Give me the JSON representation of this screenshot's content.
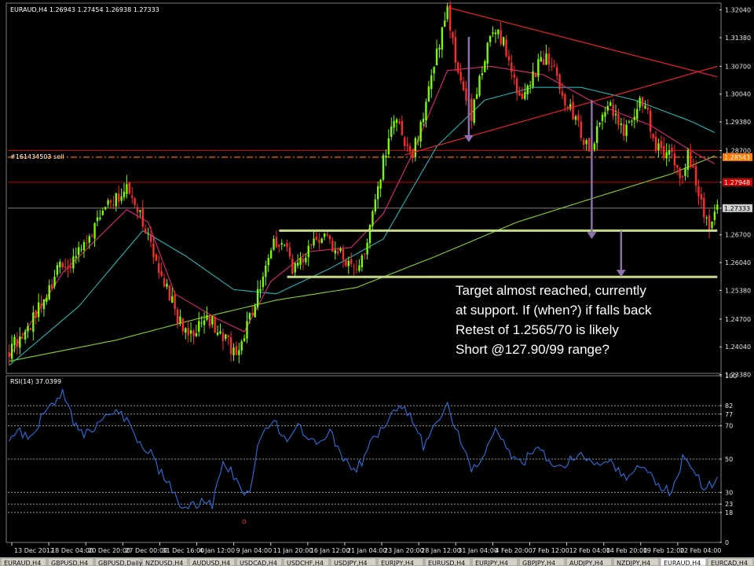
{
  "header": {
    "symbol_line": "EURAUD,H4  1.26943 1.27454 1.26938 1.27333",
    "order_label": "#161434503 sell",
    "rsi_label": "RSI(14) 37.0399"
  },
  "annotation": [
    "Target almost reached,  currently",
    "at support.  If (when?) if falls back",
    "Retest of 1.2565/70 is likely",
    "Short @127.90/99 range?"
  ],
  "colors": {
    "background": "#000000",
    "bull_candle": "#7cfc00",
    "bear_candle": "#ff2a2a",
    "ma_fast": "#e0257a",
    "ma_mid": "#27b5b5",
    "ma_slow": "#8ad22c",
    "triangle": "#e8202a",
    "support": "#c5d98a",
    "arrow": "#8d6fb0",
    "rsi_line": "#2f6fe0",
    "order_line": "#ff7a00",
    "hline_red": "#cc0000",
    "price_line": "#7f7f7f"
  },
  "chart_data": [
    {
      "type": "candlestick",
      "title": "EURAUD,H4",
      "ylim": [
        1.2341,
        1.322
      ],
      "y_ticks": [
        "1.32040",
        "1.31380",
        "1.30700",
        "1.30040",
        "1.29380",
        "1.28700",
        "1.28543",
        "1.27948",
        "1.27333",
        "1.26700",
        "1.26040",
        "1.25380",
        "1.24700",
        "1.24040",
        "1.23380"
      ],
      "x_labels": [
        "13 Dec 2012",
        "18 Dec 04:00",
        "20 Dec 20:00",
        "27 Dec 00:00",
        "31 Dec 16:00",
        "4 Jan 12:00",
        "9 Jan 04:00",
        "11 Jan 20:00",
        "16 Jan 12:00",
        "21 Jan 04:00",
        "23 Jan 20:00",
        "28 Jan 12:00",
        "31 Jan 04:00",
        "4 Feb 20:00",
        "7 Feb 12:00",
        "12 Feb 04:00",
        "14 Feb 20:00",
        "19 Feb 12:00",
        "22 Feb 04:00"
      ],
      "levels": {
        "order_sell": 1.28543,
        "resistance": 1.27948,
        "last_price": 1.27333,
        "support_upper": 1.268,
        "support_lower": 1.257
      },
      "path_points": [
        [
          0,
          1.2395
        ],
        [
          8,
          1.246
        ],
        [
          14,
          1.2525
        ],
        [
          19,
          1.2595
        ],
        [
          24,
          1.261
        ],
        [
          29,
          1.2645
        ],
        [
          33,
          1.27
        ],
        [
          38,
          1.2745
        ],
        [
          44,
          1.2785
        ],
        [
          50,
          1.27
        ],
        [
          54,
          1.263
        ],
        [
          58,
          1.2555
        ],
        [
          63,
          1.2475
        ],
        [
          68,
          1.243
        ],
        [
          72,
          1.2475
        ],
        [
          76,
          1.246
        ],
        [
          80,
          1.243
        ],
        [
          84,
          1.2395
        ],
        [
          87,
          1.241
        ],
        [
          89,
          1.246
        ],
        [
          93,
          1.253
        ],
        [
          96,
          1.259
        ],
        [
          99,
          1.265
        ],
        [
          103,
          1.266
        ],
        [
          106,
          1.259
        ],
        [
          110,
          1.261
        ],
        [
          114,
          1.266
        ],
        [
          118,
          1.267
        ],
        [
          122,
          1.264
        ],
        [
          126,
          1.261
        ],
        [
          130,
          1.26
        ],
        [
          134,
          1.265
        ],
        [
          138,
          1.279
        ],
        [
          142,
          1.29
        ],
        [
          145,
          1.294
        ],
        [
          148,
          1.288
        ],
        [
          151,
          1.2865
        ],
        [
          155,
          1.296
        ],
        [
          158,
          1.306
        ],
        [
          161,
          1.312
        ],
        [
          164,
          1.3205
        ],
        [
          167,
          1.308
        ],
        [
          170,
          1.302
        ],
        [
          173,
          1.295
        ],
        [
          176,
          1.303
        ],
        [
          179,
          1.312
        ],
        [
          182,
          1.315
        ],
        [
          185,
          1.313
        ],
        [
          188,
          1.305
        ],
        [
          191,
          1.2985
        ],
        [
          194,
          1.301
        ],
        [
          197,
          1.306
        ],
        [
          200,
          1.309
        ],
        [
          203,
          1.308
        ],
        [
          206,
          1.302
        ],
        [
          209,
          1.298
        ],
        [
          212,
          1.295
        ],
        [
          215,
          1.289
        ],
        [
          218,
          1.286
        ],
        [
          221,
          1.295
        ],
        [
          224,
          1.299
        ],
        [
          227,
          1.295
        ],
        [
          230,
          1.292
        ],
        [
          233,
          1.295
        ],
        [
          236,
          1.299
        ],
        [
          239,
          1.295
        ],
        [
          242,
          1.288
        ],
        [
          245,
          1.285
        ],
        [
          248,
          1.287
        ],
        [
          251,
          1.28
        ],
        [
          254,
          1.286
        ],
        [
          257,
          1.28
        ],
        [
          260,
          1.271
        ],
        [
          263,
          1.269
        ],
        [
          265,
          1.2733
        ]
      ],
      "ma_points": {
        "fast": [
          [
            0,
            1.238
          ],
          [
            20,
            1.258
          ],
          [
            44,
            1.273
          ],
          [
            52,
            1.27
          ],
          [
            62,
            1.253
          ],
          [
            78,
            1.247
          ],
          [
            88,
            1.244
          ],
          [
            98,
            1.256
          ],
          [
            112,
            1.263
          ],
          [
            128,
            1.264
          ],
          [
            140,
            1.272
          ],
          [
            150,
            1.285
          ],
          [
            164,
            1.306
          ],
          [
            180,
            1.307
          ],
          [
            200,
            1.305
          ],
          [
            220,
            1.298
          ],
          [
            240,
            1.293
          ],
          [
            255,
            1.287
          ],
          [
            265,
            1.2835
          ]
        ],
        "mid": [
          [
            0,
            1.236
          ],
          [
            26,
            1.25
          ],
          [
            50,
            1.268
          ],
          [
            66,
            1.262
          ],
          [
            84,
            1.254
          ],
          [
            100,
            1.253
          ],
          [
            120,
            1.259
          ],
          [
            140,
            1.266
          ],
          [
            160,
            1.288
          ],
          [
            178,
            1.299
          ],
          [
            196,
            1.302
          ],
          [
            214,
            1.302
          ],
          [
            234,
            1.299
          ],
          [
            255,
            1.294
          ],
          [
            265,
            1.291
          ]
        ],
        "slow": [
          [
            0,
            1.237
          ],
          [
            40,
            1.242
          ],
          [
            70,
            1.247
          ],
          [
            100,
            1.2515
          ],
          [
            130,
            1.2545
          ],
          [
            160,
            1.262
          ],
          [
            190,
            1.27
          ],
          [
            220,
            1.276
          ],
          [
            248,
            1.2815
          ],
          [
            265,
            1.286
          ]
        ]
      },
      "triangle": {
        "top_start": [
          164,
          1.321
        ],
        "top_end": [
          265,
          1.3045
        ],
        "bottom_start": [
          148,
          1.286
        ],
        "bottom_end": [
          265,
          1.307
        ]
      },
      "support_lines": [
        {
          "x0": 101,
          "x1": 265,
          "y": 1.268
        },
        {
          "x0": 104,
          "x1": 265,
          "y": 1.257
        }
      ],
      "arrows": [
        {
          "x": 172,
          "y0": 1.314,
          "y1": 1.289
        },
        {
          "x": 218,
          "y0": 1.299,
          "y1": 1.266
        },
        {
          "x": 229,
          "y0": 1.268,
          "y1": 1.257
        }
      ]
    },
    {
      "type": "line",
      "title": "RSI(14) 37.0399",
      "ylim": [
        0,
        100
      ],
      "y_ticks": [
        "100",
        "82",
        "77",
        "70",
        "50",
        "30",
        "23",
        "18",
        "0"
      ],
      "levels": [
        82,
        77,
        70,
        50,
        30,
        23,
        18
      ],
      "rsi_points": [
        [
          0,
          59
        ],
        [
          4,
          67
        ],
        [
          8,
          62
        ],
        [
          12,
          75
        ],
        [
          16,
          83
        ],
        [
          20,
          90
        ],
        [
          24,
          72
        ],
        [
          28,
          65
        ],
        [
          32,
          70
        ],
        [
          36,
          78
        ],
        [
          40,
          80
        ],
        [
          44,
          74
        ],
        [
          48,
          60
        ],
        [
          52,
          56
        ],
        [
          56,
          44
        ],
        [
          60,
          35
        ],
        [
          62,
          28
        ],
        [
          64,
          23
        ],
        [
          68,
          21
        ],
        [
          72,
          25
        ],
        [
          76,
          22
        ],
        [
          80,
          50
        ],
        [
          84,
          40
        ],
        [
          88,
          28
        ],
        [
          90,
          32
        ],
        [
          93,
          58
        ],
        [
          96,
          68
        ],
        [
          100,
          72
        ],
        [
          104,
          58
        ],
        [
          108,
          70
        ],
        [
          112,
          64
        ],
        [
          116,
          60
        ],
        [
          120,
          66
        ],
        [
          124,
          54
        ],
        [
          128,
          42
        ],
        [
          132,
          48
        ],
        [
          136,
          62
        ],
        [
          140,
          68
        ],
        [
          144,
          78
        ],
        [
          148,
          82
        ],
        [
          152,
          70
        ],
        [
          155,
          58
        ],
        [
          158,
          66
        ],
        [
          161,
          76
        ],
        [
          164,
          82
        ],
        [
          167,
          70
        ],
        [
          170,
          58
        ],
        [
          173,
          45
        ],
        [
          176,
          50
        ],
        [
          179,
          58
        ],
        [
          182,
          68
        ],
        [
          185,
          60
        ],
        [
          188,
          50
        ],
        [
          192,
          47
        ],
        [
          196,
          55
        ],
        [
          200,
          54
        ],
        [
          204,
          44
        ],
        [
          208,
          46
        ],
        [
          212,
          52
        ],
        [
          216,
          50
        ],
        [
          220,
          46
        ],
        [
          224,
          48
        ],
        [
          228,
          44
        ],
        [
          232,
          38
        ],
        [
          236,
          46
        ],
        [
          240,
          40
        ],
        [
          244,
          34
        ],
        [
          248,
          30
        ],
        [
          252,
          50
        ],
        [
          256,
          44
        ],
        [
          260,
          32
        ],
        [
          265,
          37
        ]
      ]
    }
  ],
  "tabs": [
    "EURAUD,H4",
    "GBPUSD,H4",
    "GBPUSD,Daily",
    "NZDUSD,H4",
    "AUDUSD,H4",
    "USDCAD,H4",
    "USDCHF,H4",
    "USDJPY,H4",
    "EURJPY,H4",
    "EURUSD,H4",
    "EURJPY,H4",
    "GBPJPY,H4",
    "AUDJPY,H4",
    "NZDJPY,H4",
    "EURAUD,H4",
    "EURCAD,H4"
  ]
}
